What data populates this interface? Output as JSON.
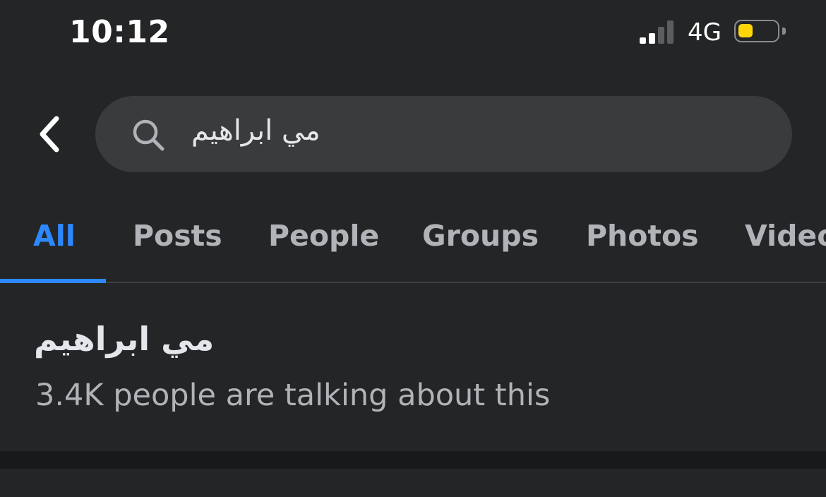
{
  "status_bar": {
    "time": "10:12",
    "network": "4G",
    "battery_color": "#ffd60a",
    "battery_level": 0.4
  },
  "search": {
    "query": "مي ابراهيم",
    "icon": "search-icon"
  },
  "tabs": [
    {
      "label": "All",
      "active": true
    },
    {
      "label": "Posts",
      "active": false
    },
    {
      "label": "People",
      "active": false
    },
    {
      "label": "Groups",
      "active": false
    },
    {
      "label": "Photos",
      "active": false
    },
    {
      "label": "Videos",
      "active": false
    }
  ],
  "result": {
    "title": "مي ابراهيم",
    "subtitle": "3.4K people are talking about this"
  },
  "colors": {
    "accent": "#2d88ff",
    "background": "#242526",
    "search_field": "#3a3b3c",
    "secondary_text": "#b0b3b8"
  }
}
